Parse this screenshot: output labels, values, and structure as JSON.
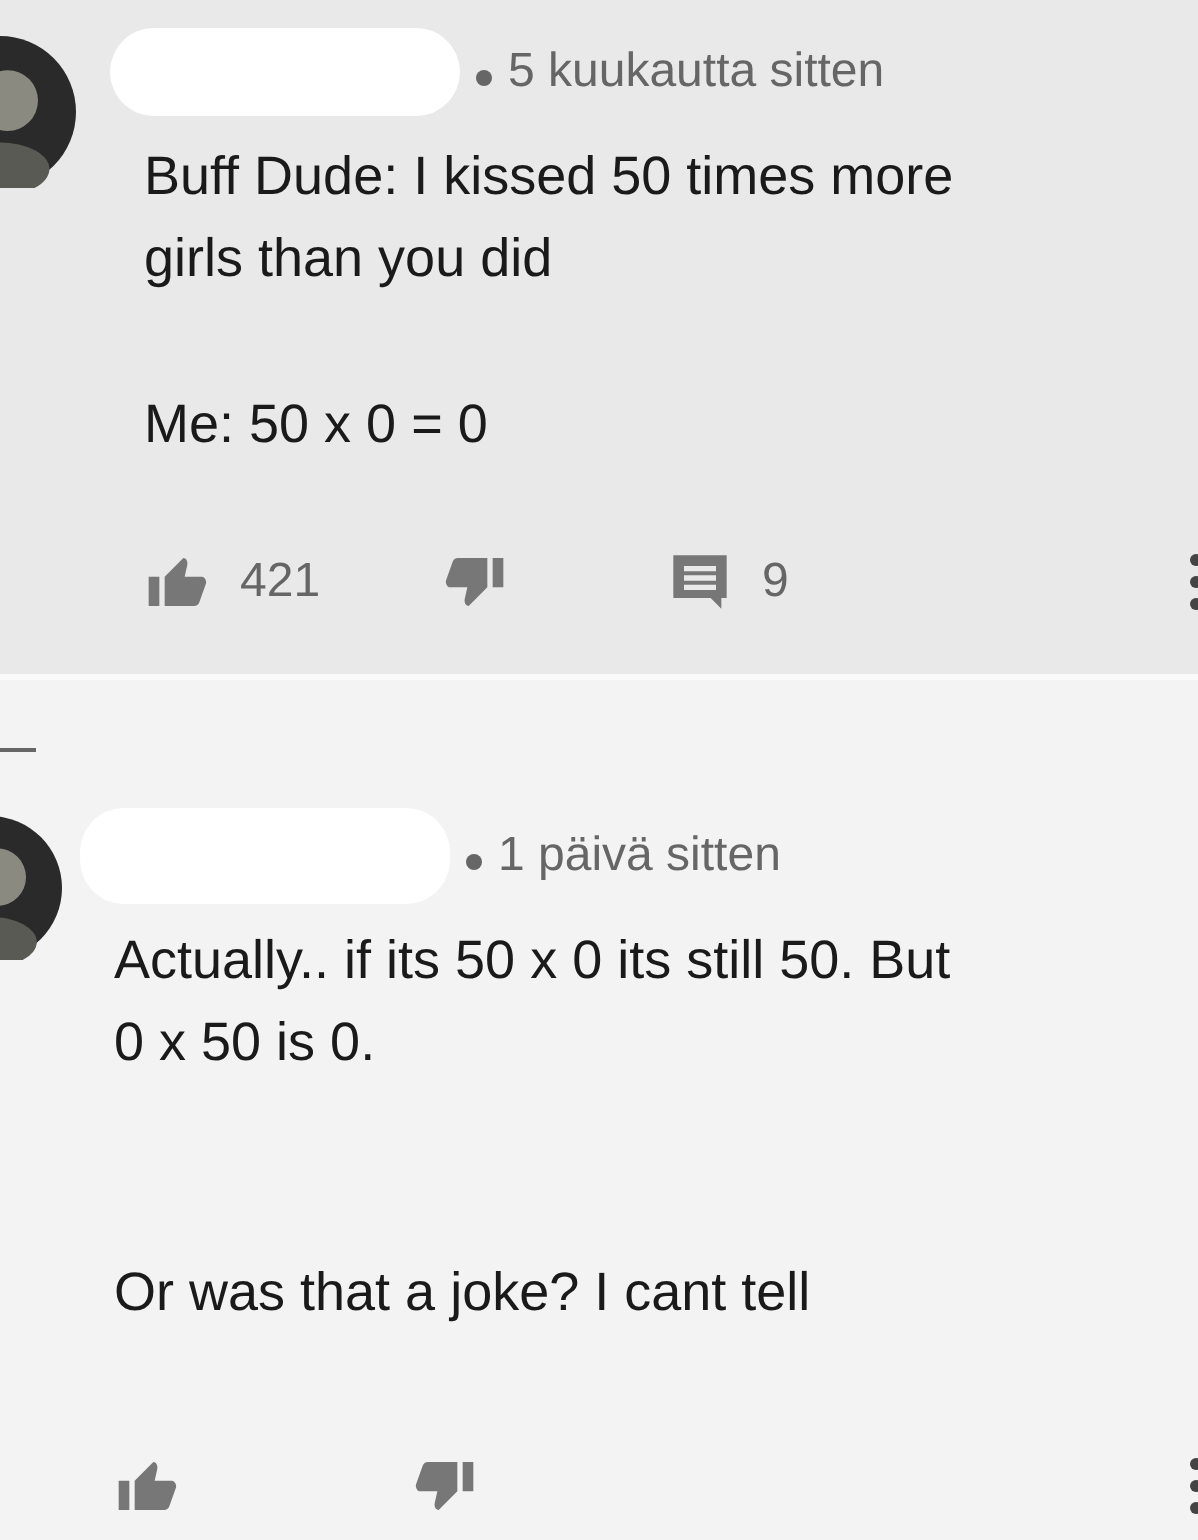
{
  "comments": [
    {
      "time": "5 kuukautta sitten",
      "paragraphs": [
        [
          "Buff Dude: I kissed 50 times more",
          "girls than you did"
        ],
        [
          "Me: 50 x 0 = 0"
        ]
      ],
      "likes": "421",
      "replies": "9"
    },
    {
      "time": "1 päivä sitten",
      "paragraphs": [
        [
          "Actually.. if its 50 x 0 its still 50. But",
          "0 x 50 is 0."
        ],
        [
          "Or was that a joke? I cant tell"
        ]
      ]
    }
  ]
}
